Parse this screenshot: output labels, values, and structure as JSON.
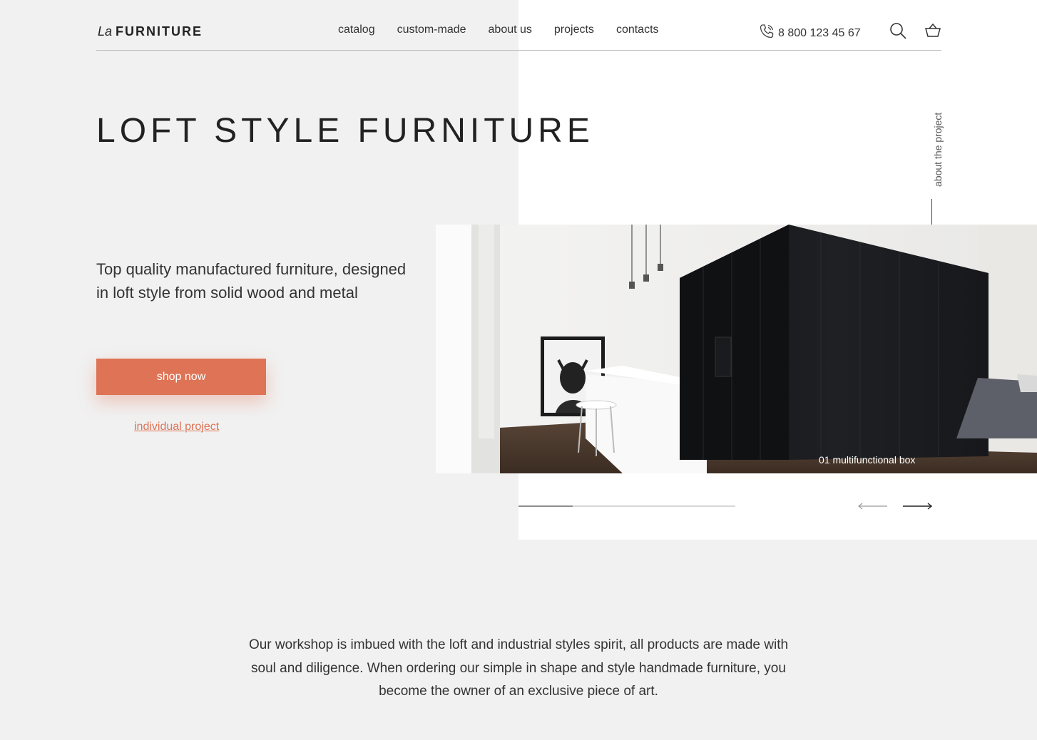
{
  "header": {
    "logo_prefix": "La",
    "logo_brand": "FURNITURE",
    "nav": [
      "catalog",
      "custom-made",
      "about us",
      "projects",
      "contacts"
    ],
    "phone": "8 800 123 45 67",
    "icons": [
      "phone-icon",
      "search-icon",
      "basket-icon"
    ]
  },
  "hero": {
    "title": "LOFT STYLE FURNITURE",
    "description": "Top quality manufactured furniture, designed in loft style from solid wood and metal",
    "shop_button": "shop now",
    "individual_link": "individual project",
    "vertical_label": "about the project"
  },
  "slider": {
    "caption": "01 multifunctional box",
    "progress": 0.25,
    "icons": [
      "arrow-left-icon",
      "arrow-right-icon"
    ]
  },
  "about": {
    "text": "Our workshop is imbued with the loft and industrial styles spirit, all products are made with soul and diligence. When ordering our simple in shape and style handmade furniture, you become the owner of an exclusive piece of art."
  },
  "colors": {
    "accent": "#df7356",
    "background": "#f1f1f1",
    "panel": "#ffffff",
    "text": "#2b2b2b"
  }
}
